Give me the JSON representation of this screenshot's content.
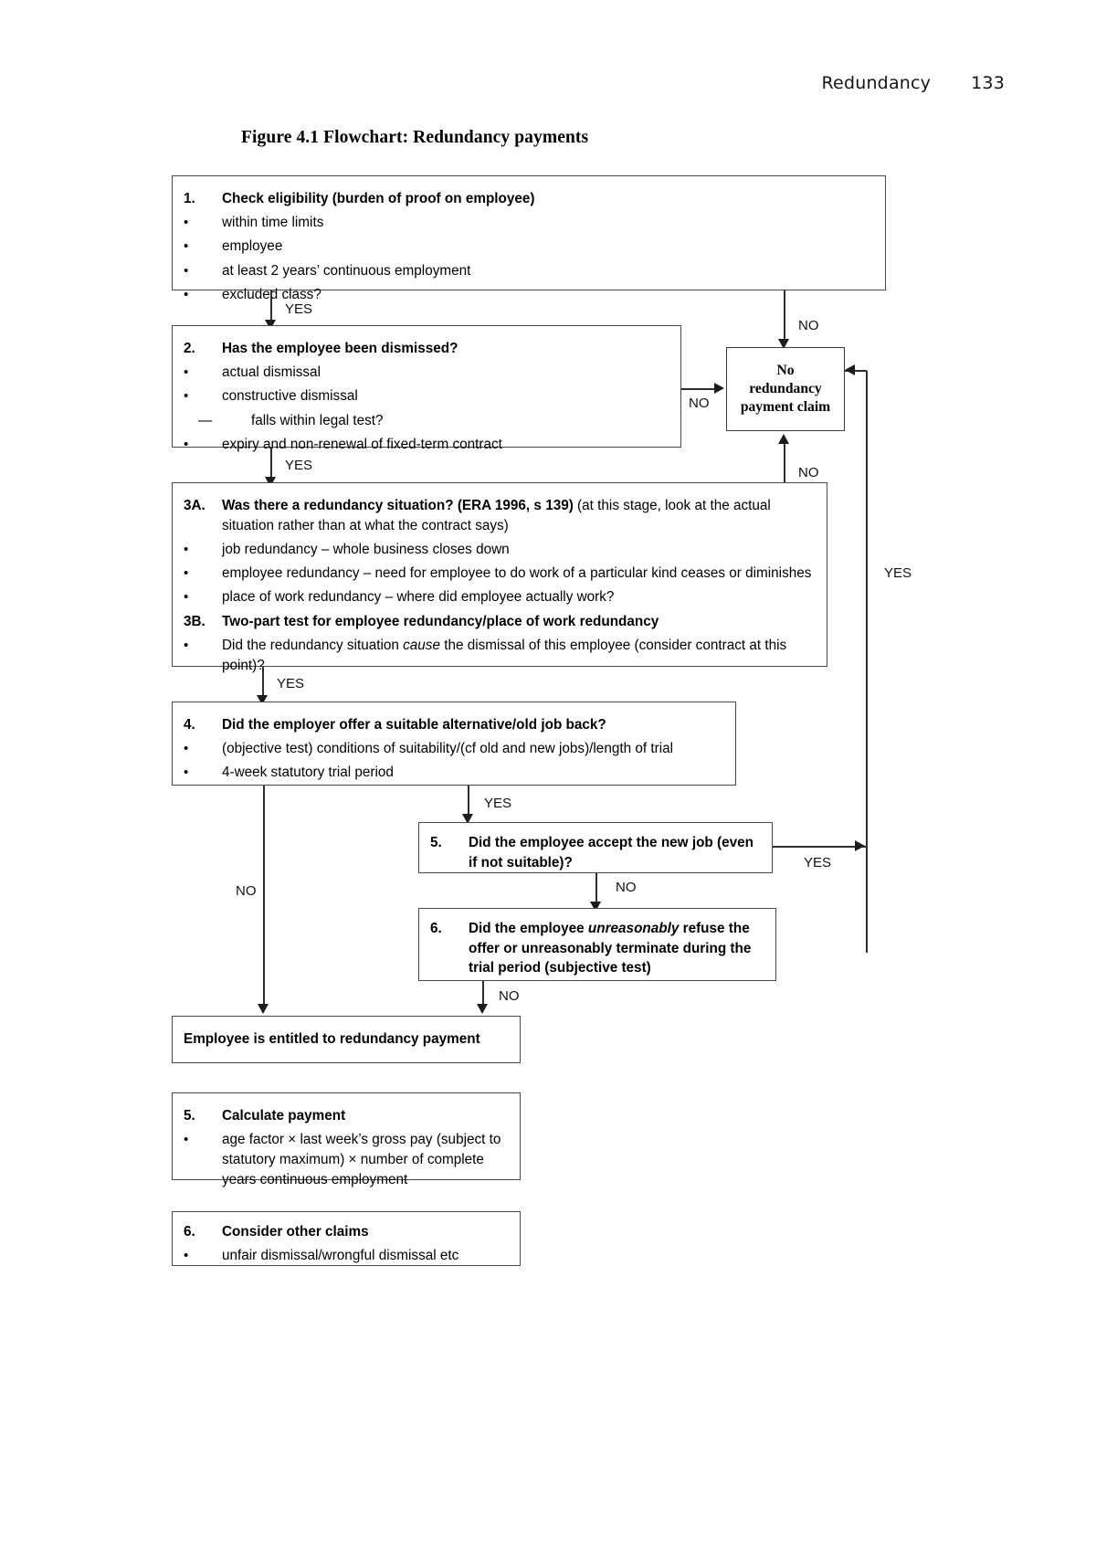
{
  "header": {
    "chapter": "Redundancy",
    "page_number": "133"
  },
  "figure": {
    "title": "Figure 4.1 Flowchart: Redundancy payments"
  },
  "boxes": {
    "step1": {
      "number": "1.",
      "heading": "Check eligibility (burden of proof on employee)",
      "bullets": [
        "within time limits",
        "employee",
        "at least 2 years’ continuous employment",
        "excluded class?"
      ]
    },
    "step2": {
      "number": "2.",
      "heading": "Has the employee been dismissed?",
      "bullets": [
        "actual dismissal",
        "constructive dismissal"
      ],
      "subdash": "falls within legal test?",
      "bullet_last": "expiry and non-renewal of fixed-term contract"
    },
    "step3": {
      "number_a": "3A.",
      "heading_a_bold": "Was there a redundancy situation? (ERA 1996, s 139)",
      "heading_a_rest": " (at this stage, look at the actual situation rather than at what the contract says)",
      "bullets_a": [
        "job redundancy – whole business closes down",
        "employee redundancy – need for employee to do work of a particular kind ceases or diminishes",
        "place of work redundancy – where did employee actually work?"
      ],
      "number_b": "3B.",
      "heading_b": "Two-part test for employee redundancy/place of work redundancy",
      "bullet_b_pre": "Did the redundancy situation ",
      "bullet_b_italic": "cause",
      "bullet_b_post": " the dismissal of this employee (consider contract at this point)?"
    },
    "step4": {
      "number": "4.",
      "heading": "Did the employer offer a suitable alternative/old job back?",
      "bullets": [
        "(objective test) conditions of suitability/(cf old and new jobs)/length of trial",
        "4-week statutory trial period"
      ]
    },
    "step5_accept": {
      "number": "5.",
      "heading": "Did the employee accept the new job (even if not suitable)?"
    },
    "step6_refuse": {
      "number": "6.",
      "heading_pre": "Did the employee ",
      "heading_italic": "unreasonably",
      "heading_post": " refuse the offer or unreasonably terminate during the trial period (subjective test)"
    },
    "entitled": {
      "text": "Employee is entitled to redundancy payment"
    },
    "no_claim": {
      "line1": "No",
      "line2": "redundancy",
      "line3": "payment claim"
    },
    "step5_calc": {
      "number": "5.",
      "heading": "Calculate payment",
      "bullet": "age factor × last week’s gross pay (subject to statutory maximum) × number of complete years continuous employment"
    },
    "step6_other": {
      "number": "6.",
      "heading": "Consider other claims",
      "bullet": "unfair dismissal/wrongful dismissal etc"
    }
  },
  "edges": {
    "yes_1_2": "YES",
    "no_1_claim": "NO",
    "yes_2_3": "YES",
    "no_2_claim": "NO",
    "yes_3_4": "YES",
    "no_3_claim": "NO",
    "yes_4_5": "YES",
    "no_4_entitled": "NO",
    "yes_5_claim": "YES",
    "no_5_6": "NO",
    "no_6_entitled": "NO",
    "yes_right_rail": "YES"
  },
  "colors": {
    "border": "#4a4a4a",
    "line": "#2e2e2e",
    "text": "#000000"
  }
}
